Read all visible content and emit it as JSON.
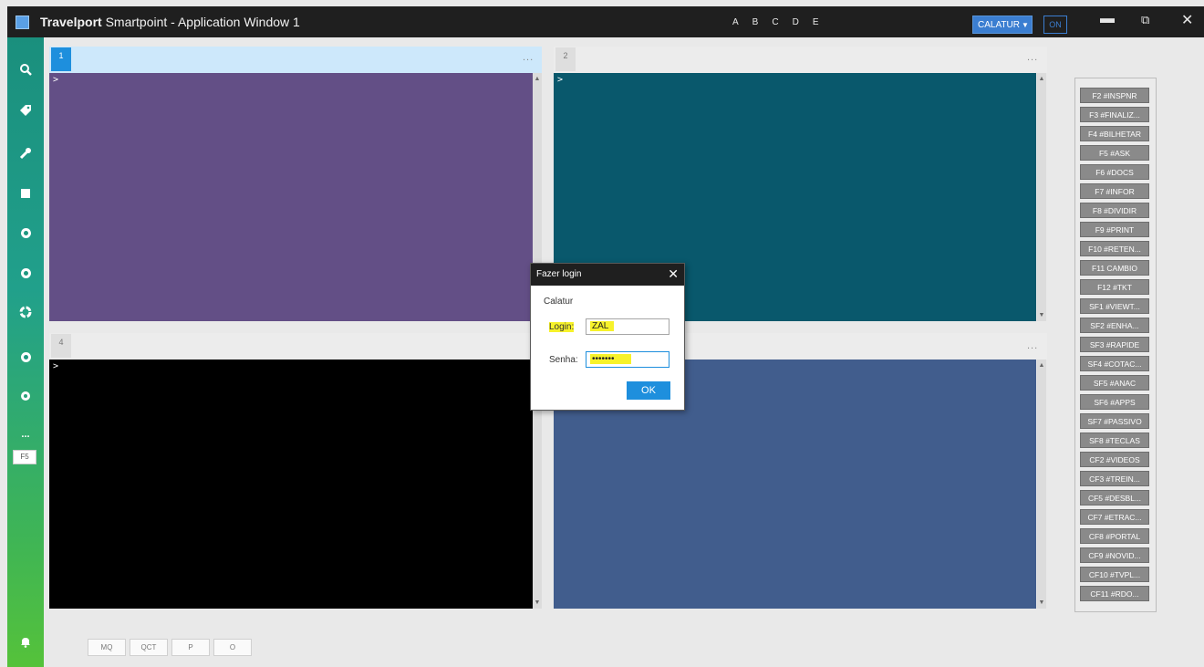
{
  "window": {
    "title_brand": "Travelport",
    "title_rest": " Smartpoint - Application Window 1",
    "workareas": [
      "A",
      "B",
      "C",
      "D",
      "E"
    ],
    "profile": "CALATUR",
    "on_label": "ON"
  },
  "sidebar": {
    "icons": [
      "search-icon",
      "tag-icon",
      "wrench-icon",
      "square-icon",
      "circle-icon-1",
      "circle-icon-2",
      "recycle-icon",
      "help-icon",
      "settings-icon",
      "more-icon"
    ],
    "more_label": "...",
    "f5_label": "F5"
  },
  "panels": [
    {
      "number": "1",
      "prompt": ">",
      "color": "#634f86"
    },
    {
      "number": "2",
      "prompt": ">",
      "color": "#09586c"
    },
    {
      "number": "4",
      "prompt": ">",
      "color": "#000000"
    },
    {
      "number": "",
      "prompt": "",
      "color": "#415d8d"
    }
  ],
  "panel_menu": "...",
  "fkeys": [
    "F2 #INSPNR",
    "F3 #FINALIZ...",
    "F4 #BILHETAR",
    "F5 #ASK",
    "F6 #DOCS",
    "F7 #INFOR",
    "F8 #DIVIDIR",
    "F9 #PRINT",
    "F10 #RETEN...",
    "F11 CAMBIO",
    "F12 #TKT",
    "SF1 #VIEWT...",
    "SF2 #ENHA...",
    "SF3 #RAPIDE",
    "SF4 #COTAC...",
    "SF5 #ANAC",
    "SF6 #APPS",
    "SF7 #PASSIVO",
    "SF8 #TECLAS",
    "CF2 #VIDEOS",
    "CF3 #TREIN...",
    "CF5 #DESBL...",
    "CF7 #ETRAC...",
    "CF8 #PORTAL",
    "CF9 #NOVID...",
    "CF10 #TVPL...",
    "CF11 #RDO..."
  ],
  "bottom_buttons": [
    "MQ",
    "QCT",
    "P",
    "O"
  ],
  "dialog": {
    "title": "Fazer login",
    "close": "✕",
    "agency": "Calatur",
    "login_label": "Login:",
    "login_value": "ZAL",
    "password_label": "Senha:",
    "password_value": "•••••••",
    "ok_label": "OK"
  }
}
